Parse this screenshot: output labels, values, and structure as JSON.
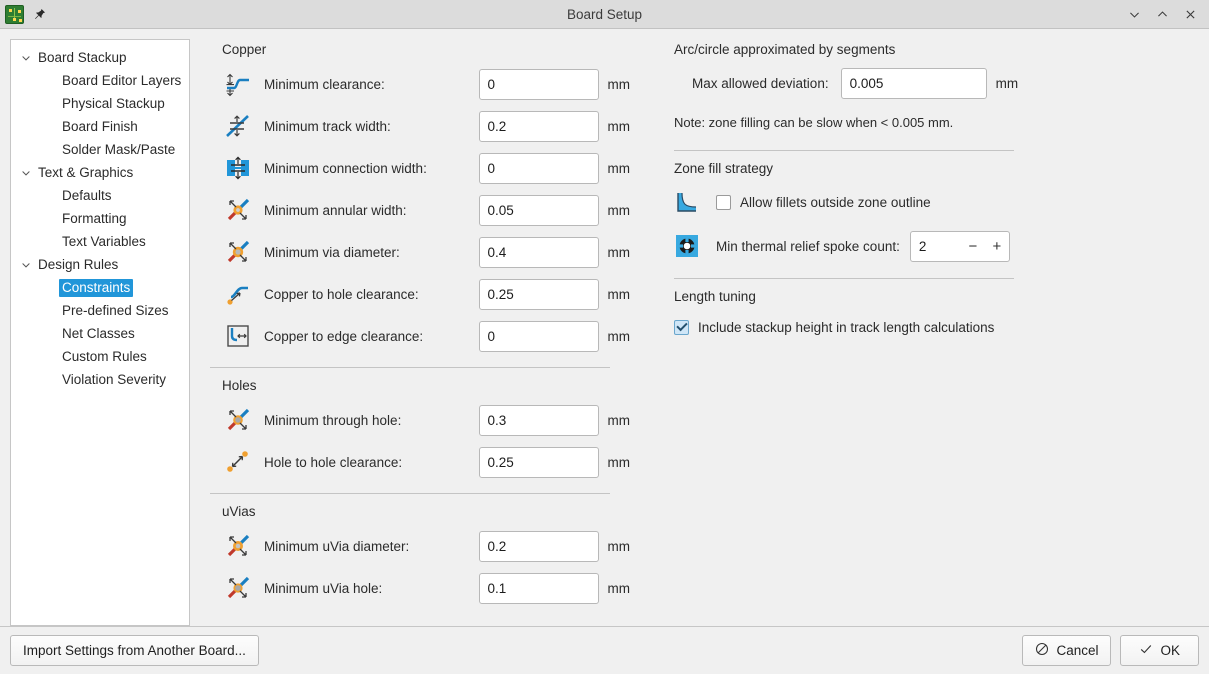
{
  "window": {
    "title": "Board Setup",
    "app_icon": "kicad-pcb-icon",
    "pin_icon": "pin-icon",
    "minimize_icon": "chevron-down-icon",
    "maximize_icon": "chevron-up-icon",
    "close_icon": "close-icon"
  },
  "sidebar": {
    "items": [
      {
        "label": "Board Stackup",
        "level": 0,
        "expanded": true,
        "selected": false
      },
      {
        "label": "Board Editor Layers",
        "level": 1,
        "expanded": null,
        "selected": false
      },
      {
        "label": "Physical Stackup",
        "level": 1,
        "expanded": null,
        "selected": false
      },
      {
        "label": "Board Finish",
        "level": 1,
        "expanded": null,
        "selected": false
      },
      {
        "label": "Solder Mask/Paste",
        "level": 1,
        "expanded": null,
        "selected": false
      },
      {
        "label": "Text & Graphics",
        "level": 0,
        "expanded": true,
        "selected": false
      },
      {
        "label": "Defaults",
        "level": 1,
        "expanded": null,
        "selected": false
      },
      {
        "label": "Formatting",
        "level": 1,
        "expanded": null,
        "selected": false
      },
      {
        "label": "Text Variables",
        "level": 1,
        "expanded": null,
        "selected": false
      },
      {
        "label": "Design Rules",
        "level": 0,
        "expanded": true,
        "selected": false
      },
      {
        "label": "Constraints",
        "level": 1,
        "expanded": null,
        "selected": true
      },
      {
        "label": "Pre-defined Sizes",
        "level": 1,
        "expanded": null,
        "selected": false
      },
      {
        "label": "Net Classes",
        "level": 1,
        "expanded": null,
        "selected": false
      },
      {
        "label": "Custom Rules",
        "level": 1,
        "expanded": null,
        "selected": false
      },
      {
        "label": "Violation Severity",
        "level": 1,
        "expanded": null,
        "selected": false
      }
    ]
  },
  "copper": {
    "title": "Copper",
    "fields": [
      {
        "icon": "min-clearance-icon",
        "label": "Minimum clearance:",
        "value": "0",
        "unit": "mm"
      },
      {
        "icon": "min-track-width-icon",
        "label": "Minimum track width:",
        "value": "0.2",
        "unit": "mm"
      },
      {
        "icon": "min-connection-width-icon",
        "label": "Minimum connection width:",
        "value": "0",
        "unit": "mm"
      },
      {
        "icon": "min-annular-width-icon",
        "label": "Minimum annular width:",
        "value": "0.05",
        "unit": "mm"
      },
      {
        "icon": "min-via-diameter-icon",
        "label": "Minimum via diameter:",
        "value": "0.4",
        "unit": "mm"
      },
      {
        "icon": "copper-to-hole-icon",
        "label": "Copper to hole clearance:",
        "value": "0.25",
        "unit": "mm"
      },
      {
        "icon": "copper-to-edge-icon",
        "label": "Copper to edge clearance:",
        "value": "0",
        "unit": "mm"
      }
    ]
  },
  "holes": {
    "title": "Holes",
    "fields": [
      {
        "icon": "min-through-hole-icon",
        "label": "Minimum through hole:",
        "value": "0.3",
        "unit": "mm"
      },
      {
        "icon": "hole-to-hole-icon",
        "label": "Hole to hole clearance:",
        "value": "0.25",
        "unit": "mm"
      }
    ]
  },
  "uvias": {
    "title": "uVias",
    "fields": [
      {
        "icon": "min-uvia-diameter-icon",
        "label": "Minimum uVia diameter:",
        "value": "0.2",
        "unit": "mm"
      },
      {
        "icon": "min-uvia-hole-icon",
        "label": "Minimum uVia hole:",
        "value": "0.1",
        "unit": "mm"
      }
    ]
  },
  "arc_circle": {
    "title": "Arc/circle approximated by segments",
    "deviation_label": "Max allowed deviation:",
    "deviation_value": "0.005",
    "deviation_unit": "mm",
    "note": "Note: zone filling can be slow when < 0.005 mm."
  },
  "zone_fill": {
    "title": "Zone fill strategy",
    "fillets_icon": "zone-fillet-icon",
    "fillets_label": "Allow fillets outside zone outline",
    "fillets_checked": false,
    "spoke_icon": "thermal-spoke-icon",
    "spoke_label": "Min thermal relief spoke count:",
    "spoke_value": "2",
    "spoke_minus": "−",
    "spoke_plus": "+"
  },
  "length_tuning": {
    "title": "Length tuning",
    "stackup_label": "Include stackup height in track length calculations",
    "stackup_checked": true
  },
  "footer": {
    "import_label": "Import Settings from Another Board...",
    "cancel_label": "Cancel",
    "cancel_icon": "cancel-circle-icon",
    "ok_label": "OK",
    "ok_icon": "check-icon"
  },
  "colors": {
    "accent": "#2196d9",
    "dialog_bg": "#f0f0f0",
    "titlebar_bg": "#dcdcdc",
    "tree_bg": "#ffffff"
  }
}
